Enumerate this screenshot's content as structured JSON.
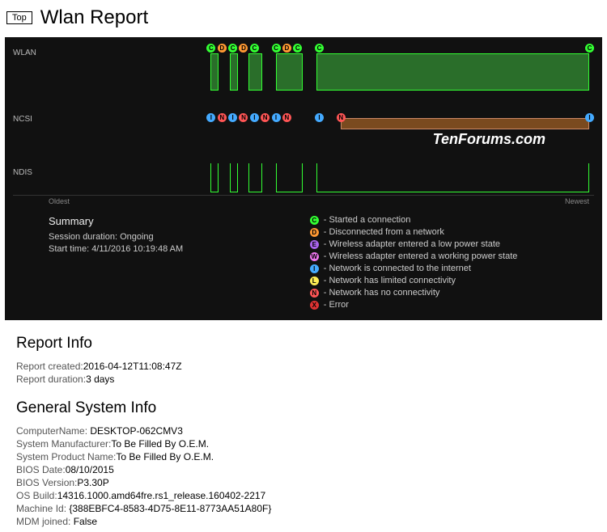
{
  "header": {
    "top_button": "Top",
    "title": "Wlan Report"
  },
  "chart": {
    "lanes": [
      "WLAN",
      "NCSI",
      "NDIS"
    ],
    "axis_left": "Oldest",
    "axis_right": "Newest",
    "watermark": "TenForums.com"
  },
  "summary": {
    "heading": "Summary",
    "session_label": "Session duration: ",
    "session_val": "Ongoing",
    "start_label": "Start time: ",
    "start_val": "4/11/2016 10:19:48 AM"
  },
  "legend": [
    {
      "key": "C",
      "cls": "d-c",
      "text": "- Started a connection"
    },
    {
      "key": "D",
      "cls": "d-d",
      "text": "- Disconnected from a network"
    },
    {
      "key": "E",
      "cls": "d-e",
      "text": "- Wireless adapter entered a low power state"
    },
    {
      "key": "W",
      "cls": "d-w",
      "text": "- Wireless adapter entered a working power state"
    },
    {
      "key": "I",
      "cls": "d-i",
      "text": "- Network is connected to the internet"
    },
    {
      "key": "L",
      "cls": "d-l",
      "text": "- Network has limited connectivity"
    },
    {
      "key": "N",
      "cls": "d-n",
      "text": "- Network has no connectivity"
    },
    {
      "key": "X",
      "cls": "d-x",
      "text": "- Error"
    }
  ],
  "report_info": {
    "heading": "Report Info",
    "items": [
      {
        "k": "Report created:",
        "v": "2016-04-12T11:08:47Z"
      },
      {
        "k": "Report duration:",
        "v": "3 days"
      }
    ]
  },
  "system_info": {
    "heading": "General System Info",
    "items": [
      {
        "k": "ComputerName: ",
        "v": "DESKTOP-062CMV3"
      },
      {
        "k": "System Manufacturer:",
        "v": "To Be Filled By O.E.M."
      },
      {
        "k": "System Product Name:",
        "v": "To Be Filled By O.E.M."
      },
      {
        "k": "BIOS Date:",
        "v": "08/10/2015"
      },
      {
        "k": "BIOS Version:",
        "v": "P3.30P"
      },
      {
        "k": "OS Build:",
        "v": "14316.1000.amd64fre.rs1_release.160402-2217"
      },
      {
        "k": "Machine Id: ",
        "v": "{388EBFC4-8583-4D75-8E11-8773AA51A80F}"
      },
      {
        "k": "MDM joined: ",
        "v": "False"
      }
    ]
  },
  "chart_data": {
    "type": "timeline",
    "lanes": [
      "WLAN",
      "NCSI",
      "NDIS"
    ],
    "wlan_events": [
      {
        "pos": 30,
        "type": "C"
      },
      {
        "pos": 32,
        "type": "D"
      },
      {
        "pos": 34,
        "type": "C"
      },
      {
        "pos": 36,
        "type": "D"
      },
      {
        "pos": 38,
        "type": "C"
      },
      {
        "pos": 42,
        "type": "C"
      },
      {
        "pos": 44,
        "type": "D"
      },
      {
        "pos": 46,
        "type": "C"
      },
      {
        "pos": 50,
        "type": "C"
      },
      {
        "pos": 100,
        "type": "C"
      }
    ],
    "wlan_bars": [
      {
        "start": 30,
        "end": 31.5
      },
      {
        "start": 33.5,
        "end": 35
      },
      {
        "start": 37,
        "end": 39.5
      },
      {
        "start": 42,
        "end": 47
      },
      {
        "start": 49.5,
        "end": 100
      }
    ],
    "ncsi_events": [
      {
        "pos": 30,
        "type": "I"
      },
      {
        "pos": 32,
        "type": "N"
      },
      {
        "pos": 34,
        "type": "I"
      },
      {
        "pos": 36,
        "type": "N"
      },
      {
        "pos": 38,
        "type": "I"
      },
      {
        "pos": 40,
        "type": "N"
      },
      {
        "pos": 42,
        "type": "I"
      },
      {
        "pos": 44,
        "type": "N"
      },
      {
        "pos": 50,
        "type": "I"
      },
      {
        "pos": 54,
        "type": "N"
      },
      {
        "pos": 100,
        "type": "I"
      }
    ],
    "ncsi_bars": [
      {
        "start": 54,
        "end": 100
      }
    ],
    "ndis_bars": [
      {
        "start": 30,
        "end": 31.5
      },
      {
        "start": 33.5,
        "end": 35
      },
      {
        "start": 37,
        "end": 39.5
      },
      {
        "start": 42,
        "end": 47
      },
      {
        "start": 49.5,
        "end": 100
      }
    ]
  }
}
